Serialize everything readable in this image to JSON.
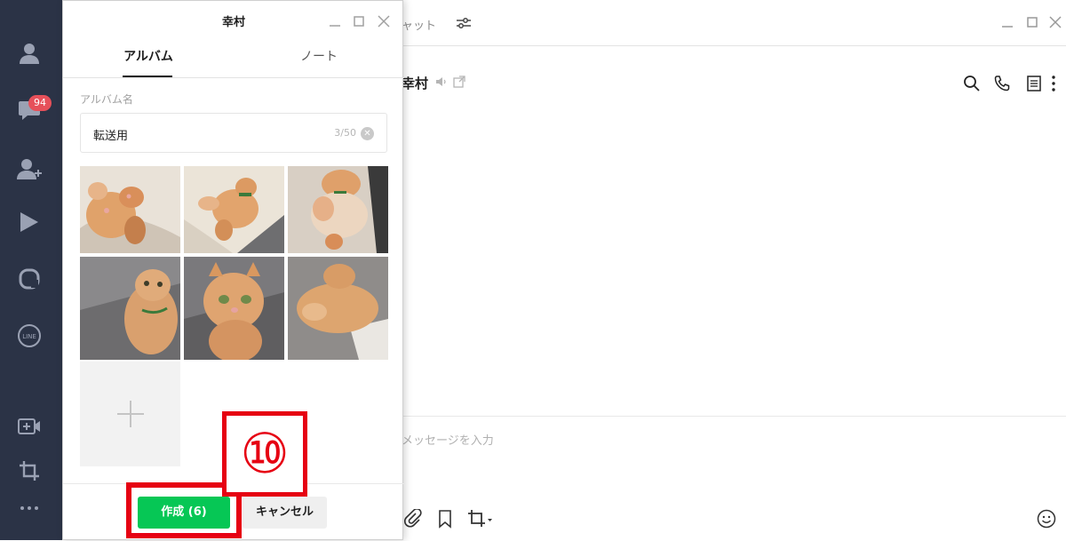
{
  "rail": {
    "badge_count": "94",
    "icons": [
      "profile-icon",
      "chat-icon",
      "add-friend-icon",
      "play-icon",
      "square-app-icon",
      "line-icon",
      "video-call-icon",
      "crop-icon",
      "more-icon"
    ]
  },
  "main": {
    "tab_partial": "ャット",
    "chat_title": "幸村",
    "input_placeholder": "メッセージを入力"
  },
  "dialog": {
    "title": "幸村",
    "tabs": [
      {
        "label": "アルバム",
        "active": true
      },
      {
        "label": "ノート",
        "active": false
      }
    ],
    "album_name_label": "アルバム名",
    "album_name_value": "転送用",
    "char_count": "3/50",
    "photo_count": 6,
    "create_button": "作成 (6)",
    "cancel_button": "キャンセル"
  },
  "annotation": {
    "step_number": "⑩",
    "color": "#e60012"
  },
  "colors": {
    "rail_bg": "#2b3346",
    "accent_green": "#06c755",
    "badge_red": "#e6505a"
  }
}
